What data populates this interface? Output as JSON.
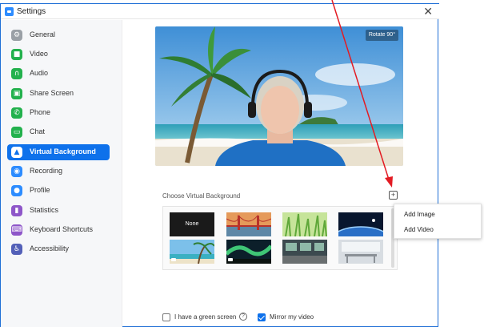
{
  "window": {
    "title": "Settings",
    "close_glyph": "✕"
  },
  "sidebar": {
    "items": [
      {
        "label": "General",
        "icon": "gear-icon",
        "color": "#9aa0a6",
        "glyph": "⚙"
      },
      {
        "label": "Video",
        "icon": "video-icon",
        "color": "#23b14d",
        "glyph": "■"
      },
      {
        "label": "Audio",
        "icon": "headphones-icon",
        "color": "#23b14d",
        "glyph": "∩"
      },
      {
        "label": "Share Screen",
        "icon": "share-screen-icon",
        "color": "#23b14d",
        "glyph": "▣"
      },
      {
        "label": "Phone",
        "icon": "phone-icon",
        "color": "#23b14d",
        "glyph": "✆"
      },
      {
        "label": "Chat",
        "icon": "chat-icon",
        "color": "#23b14d",
        "glyph": "▭"
      },
      {
        "label": "Virtual Background",
        "icon": "person-icon",
        "color": "#0e71eb",
        "glyph": "▲",
        "active": true
      },
      {
        "label": "Recording",
        "icon": "record-icon",
        "color": "#2d8cff",
        "glyph": "◉"
      },
      {
        "label": "Profile",
        "icon": "profile-icon",
        "color": "#2d8cff",
        "glyph": "●"
      },
      {
        "label": "Statistics",
        "icon": "statistics-icon",
        "color": "#8e56c9",
        "glyph": "▮"
      },
      {
        "label": "Keyboard Shortcuts",
        "icon": "keyboard-icon",
        "color": "#8e56c9",
        "glyph": "⌨"
      },
      {
        "label": "Accessibility",
        "icon": "accessibility-icon",
        "color": "#5360b8",
        "glyph": "♿"
      }
    ]
  },
  "preview": {
    "rotate_label": "Rotate 90°"
  },
  "virtual_background": {
    "section_title": "Choose Virtual Background",
    "add_glyph": "+",
    "thumbnails": [
      {
        "name": "none",
        "label": "None"
      },
      {
        "name": "golden-gate"
      },
      {
        "name": "grass"
      },
      {
        "name": "earth-space"
      },
      {
        "name": "beach-video"
      },
      {
        "name": "aurora-video"
      },
      {
        "name": "office-interior"
      },
      {
        "name": "modern-office"
      }
    ]
  },
  "context_menu": {
    "items": [
      "Add Image",
      "Add Video"
    ]
  },
  "options": {
    "green_screen": {
      "label": "I have a green screen",
      "checked": false
    },
    "mirror": {
      "label": "Mirror my video",
      "checked": true
    },
    "help_glyph": "?"
  },
  "colors": {
    "accent": "#0e71eb",
    "annotation_arrow": "#e31b23"
  }
}
